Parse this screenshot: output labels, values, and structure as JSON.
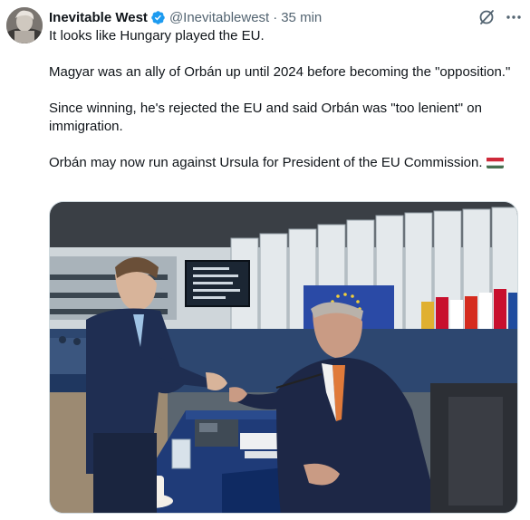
{
  "author": {
    "display_name": "Inevitable West",
    "handle": "@Inevitablewest",
    "time": "35 min",
    "separator": "·"
  },
  "tweet": {
    "paragraphs": [
      "It looks like Hungary played the EU.",
      "Magyar was an ally of Orbán up until 2024 before becoming the \"opposition.\"",
      "Since winning, he's rejected the EU and said Orbán was \"too lenient\" on immigration.",
      "Orbán may now run against Ursula for President of the EU Commission."
    ],
    "flag_emoji": "hungary-flag"
  },
  "icons": {
    "verified": "verified-badge-icon",
    "grok": "grok-icon",
    "more": "more-icon"
  },
  "colors": {
    "verified_blue": "#1d9bf0",
    "secondary_text": "#536471",
    "primary_text": "#0f1419",
    "border": "#cfd9de"
  }
}
